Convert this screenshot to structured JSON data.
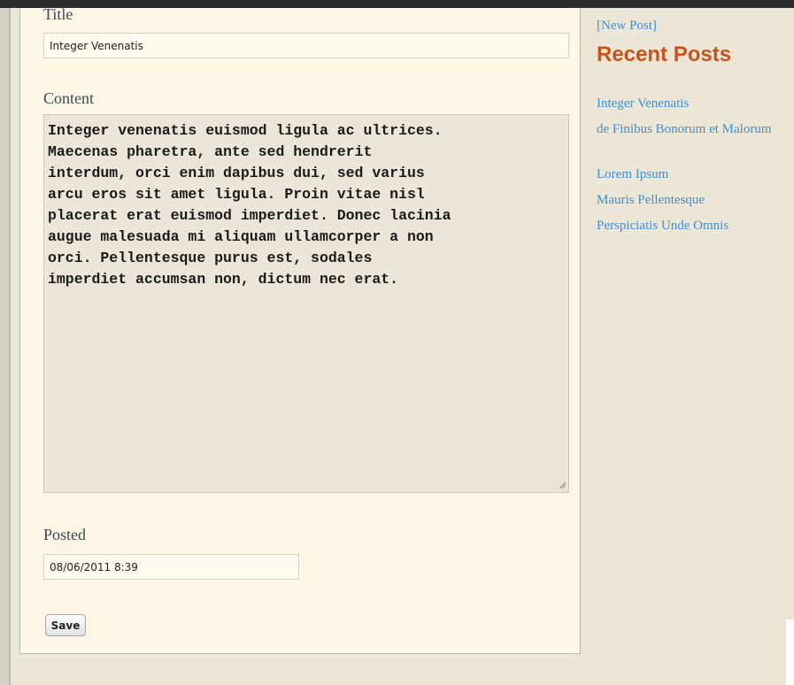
{
  "form": {
    "title_label": "Title",
    "title_value": "Integer Venenatis",
    "content_label": "Content",
    "content_value": "Integer venenatis euismod ligula ac ultrices.\nMaecenas pharetra, ante sed hendrerit\ninterdum, orci enim dapibus dui, sed varius\narcu eros sit amet ligula. Proin vitae nisl\nplacerat erat euismod imperdiet. Donec lacinia\naugue malesuada mi aliquam ullamcorper a non\norci. Pellentesque purus est, sodales\nimperdiet accumsan non, dictum nec erat.",
    "posted_label": "Posted",
    "posted_value": "08/06/2011 8:39",
    "save_label": "Save"
  },
  "sidebar": {
    "new_post_label": "[New Post]",
    "recent_title": "Recent Posts",
    "recent_posts": [
      "Integer Venenatis",
      "de Finibus Bonorum et Malorum",
      "Lorem Ipsum",
      "Mauris Pellentesque",
      "Perspiciatis Unde Omnis"
    ]
  },
  "colors": {
    "link": "#3e8ed3",
    "heading_accent": "#c8521b",
    "panel_background": "#fdf6e4",
    "page_background": "#ece6d7"
  }
}
